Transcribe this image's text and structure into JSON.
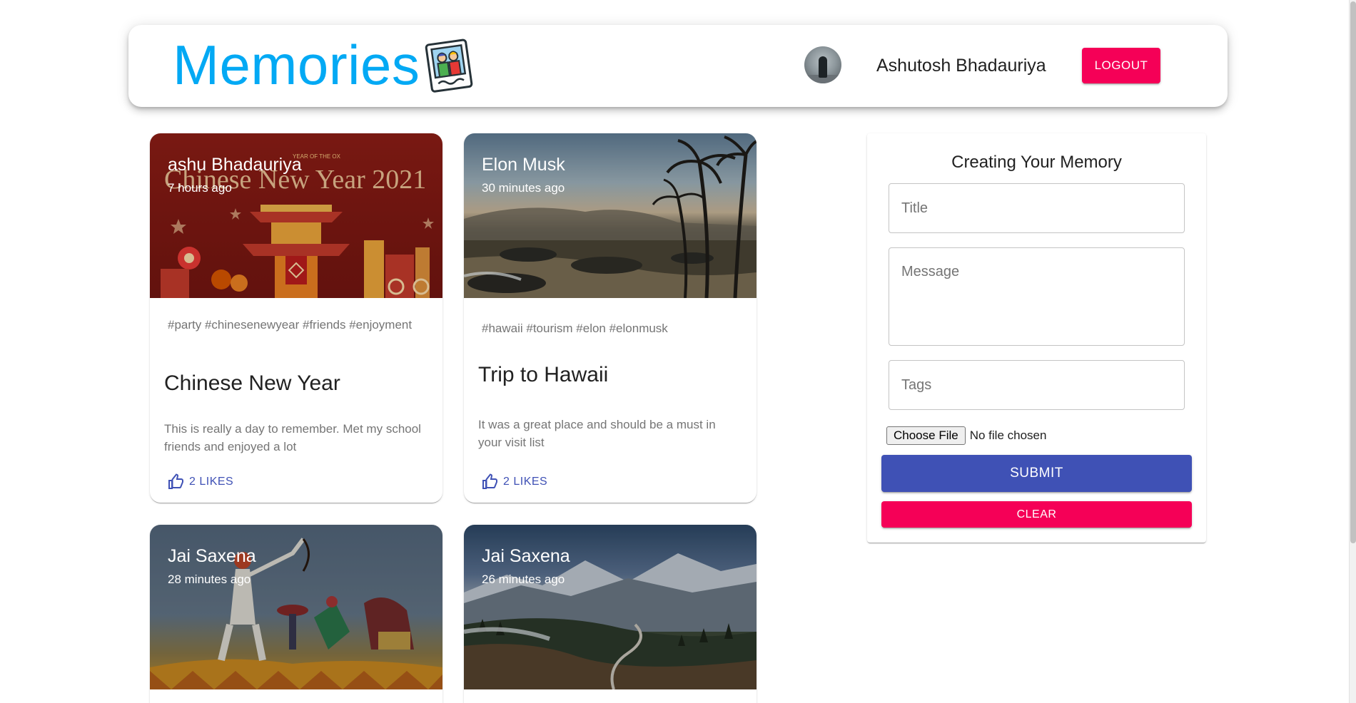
{
  "header": {
    "brand": "Memories",
    "brand_icon": "photo-memories-icon",
    "user_name": "Ashutosh Bhadauriya",
    "logout_label": "LOGOUT"
  },
  "posts": [
    {
      "author": "ashu Bhadauriya",
      "time": "7 hours ago",
      "image_text_top": "YEAR OF THE OX",
      "image_text": "Chinese New Year 2021",
      "tags": "#party #chinesenewyear #friends #enjoyment",
      "title": "Chinese New Year",
      "message": "This is really a day to remember. Met my school friends and enjoyed a lot",
      "likes": "2 LIKES"
    },
    {
      "author": "Elon Musk",
      "time": "30 minutes ago",
      "tags": "#hawaii #tourism #elon #elonmusk",
      "title": "Trip to Hawaii",
      "message": "It was a great place and should be a must in your visit list",
      "likes": "2 LIKES"
    },
    {
      "author": "Jai Saxena",
      "time": "28 minutes ago"
    },
    {
      "author": "Jai Saxena",
      "time": "26 minutes ago"
    }
  ],
  "form": {
    "heading": "Creating Your Memory",
    "title_placeholder": "Title",
    "message_placeholder": "Message",
    "tags_placeholder": "Tags",
    "file_button": "Choose File",
    "file_status": "No file chosen",
    "submit_label": "SUBMIT",
    "clear_label": "CLEAR"
  },
  "colors": {
    "brand": "#03a9f4",
    "primary": "#3f51b5",
    "secondary": "#f50057"
  }
}
